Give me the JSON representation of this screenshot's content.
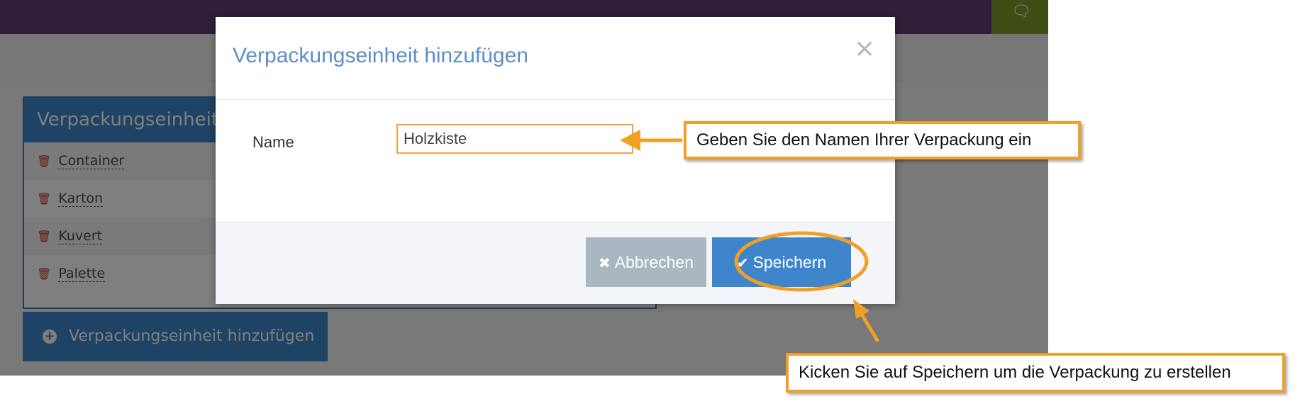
{
  "background_app": {
    "panel_title": "Verpackungseinheit",
    "items": [
      {
        "label": "Container"
      },
      {
        "label": "Karton"
      },
      {
        "label": "Kuvert"
      },
      {
        "label": "Palette"
      }
    ],
    "add_button_label": "Verpackungseinheit hinzufügen"
  },
  "modal": {
    "title": "Verpackungseinheit hinzufügen",
    "close_glyph": "×",
    "name_label": "Name",
    "name_value": "Holzkiste",
    "cancel_label": "Abbrechen",
    "save_label": "Speichern"
  },
  "annotations": {
    "callout_input": "Geben Sie den Namen Ihrer Verpackung ein",
    "callout_save": "Kicken Sie auf Speichern um die Verpackung zu erstellen"
  },
  "icons": {
    "chat": "chat-icon",
    "trash": "trash-icon",
    "plus": "plus-circle-icon",
    "cancel": "times-icon",
    "save": "check-icon"
  },
  "colors": {
    "topbar": "#5e3f74",
    "chat_button": "#7f9b2d",
    "primary": "#3e85cb",
    "cancel_button": "#a9b7c0",
    "modal_title": "#5b8fc9",
    "annotation": "#f0a023",
    "trash": "#c0392b"
  }
}
